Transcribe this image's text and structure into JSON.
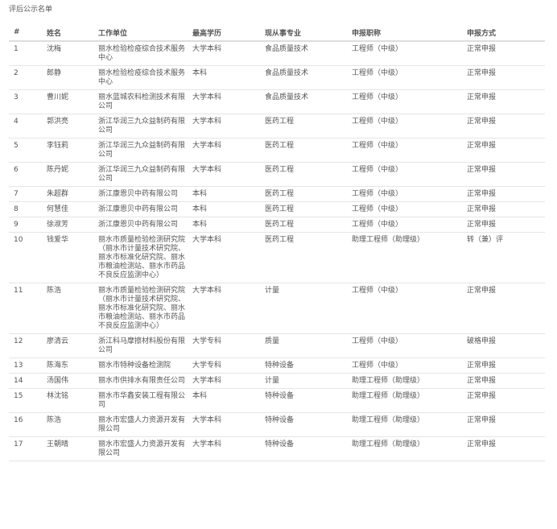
{
  "page_title": "评后公示名单",
  "headers": [
    "#",
    "姓名",
    "工作单位",
    "最高学历",
    "现从事专业",
    "申报职称",
    "申报方式"
  ],
  "rows": [
    [
      "1",
      "沈梅",
      "丽水检验检疫综合技术服务中心",
      "大学本科",
      "食品质量技术",
      "工程师（中级）",
      "正常申报"
    ],
    [
      "2",
      "郎静",
      "丽水检验检疫综合技术服务中心",
      "本科",
      "食品质量技术",
      "工程师（中级）",
      "正常申报"
    ],
    [
      "3",
      "曹川妮",
      "丽水蓝城农科检测技术有限公司",
      "大学本科",
      "食品质量技术",
      "工程师（中级）",
      "正常申报"
    ],
    [
      "4",
      "郭洪亮",
      "浙江华润三九众益制药有限公司",
      "大学本科",
      "医药工程",
      "工程师（中级）",
      "正常申报"
    ],
    [
      "5",
      "李钰莉",
      "浙江华润三九众益制药有限公司",
      "大学本科",
      "医药工程",
      "工程师（中级）",
      "正常申报"
    ],
    [
      "6",
      "陈丹妮",
      "浙江华润三九众益制药有限公司",
      "大学本科",
      "医药工程",
      "工程师（中级）",
      "正常申报"
    ],
    [
      "7",
      "朱超群",
      "浙江康恩贝中药有限公司",
      "本科",
      "医药工程",
      "工程师（中级）",
      "正常申报"
    ],
    [
      "8",
      "何慧佳",
      "浙江康恩贝中药有限公司",
      "本科",
      "医药工程",
      "工程师（中级）",
      "正常申报"
    ],
    [
      "9",
      "徐淑芳",
      "浙江康恩贝中药有限公司",
      "本科",
      "医药工程",
      "工程师（中级）",
      "正常申报"
    ],
    [
      "10",
      "钱爱华",
      "丽水市质量检验检测研究院（丽水市计量技术研究院、丽水市标准化研究院、丽水市粮油检测站、丽水市药品不良反应监测中心）",
      "大学本科",
      "医药工程",
      "助理工程师（助理级）",
      "转（兼）评"
    ],
    [
      "11",
      "陈浩",
      "丽水市质量检验检测研究院（丽水市计量技术研究院、丽水市标准化研究院、丽水市粮油检测站、丽水市药品不良反应监测中心）",
      "大学本科",
      "计量",
      "工程师（中级）",
      "正常申报"
    ],
    [
      "12",
      "廖清云",
      "浙江科马摩擦材料股份有限公司",
      "大学专科",
      "质量",
      "工程师（中级）",
      "破格申报"
    ],
    [
      "13",
      "陈海东",
      "丽水市特种设备检测院",
      "大学专科",
      "特种设备",
      "工程师（中级）",
      "正常申报"
    ],
    [
      "14",
      "汤国伟",
      "丽水市供排水有限责任公司",
      "大学本科",
      "计量",
      "助理工程师（助理级）",
      "正常申报"
    ],
    [
      "15",
      "林沈铭",
      "丽水市华鑫安装工程有限公司",
      "本科",
      "特种设备",
      "助理工程师（助理级）",
      "正常申报"
    ],
    [
      "16",
      "陈浩",
      "丽水市宏盛人力资源开发有限公司",
      "大学本科",
      "特种设备",
      "助理工程师（助理级）",
      "正常申报"
    ],
    [
      "17",
      "王朝晴",
      "丽水市宏盛人力资源开发有限公司",
      "大学本科",
      "特种设备",
      "助理工程师（助理级）",
      "正常申报"
    ]
  ]
}
